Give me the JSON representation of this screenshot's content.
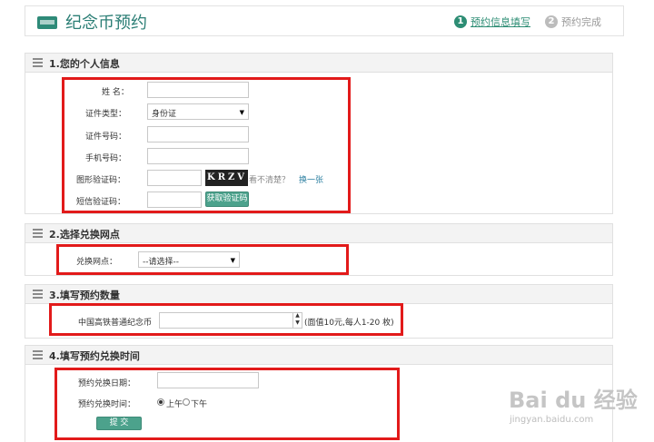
{
  "header": {
    "logo_text": "CRIT",
    "title": "纪念币预约",
    "steps": [
      {
        "num": "1",
        "label": "预约信息填写",
        "state": "active"
      },
      {
        "num": "2",
        "label": "预约完成",
        "state": "inactive"
      }
    ]
  },
  "section1": {
    "title": "1.您的个人信息",
    "name_label": "姓 名：",
    "name_value": "",
    "idtype_label": "证件类型：",
    "idtype_value": "身份证",
    "idnum_label": "证件号码：",
    "idnum_value": "",
    "phone_label": "手机号码：",
    "phone_value": "",
    "captcha_label": "图形验证码：",
    "captcha_value": "",
    "captcha_image_text": "KRZV",
    "captcha_hint": "看不清楚？",
    "captcha_refresh": "换一张",
    "sms_label": "短信验证码：",
    "sms_value": "",
    "sms_button": "获取验证码"
  },
  "section2": {
    "title": "2.选择兑换网点",
    "outlet_label": "兑换网点：",
    "outlet_value": "--请选择--"
  },
  "section3": {
    "title": "3.填写预约数量",
    "coin_label": "中国高铁普通纪念币",
    "coin_value": "",
    "coin_note": "(面值10元,每人1-20 枚)"
  },
  "section4": {
    "title": "4.填写预约兑换时间",
    "date_label": "预约兑换日期：",
    "date_value": "",
    "time_label": "预约兑换时间：",
    "time_options": [
      "上午",
      "下午"
    ],
    "time_selected": "上午",
    "submit_button": "提 交"
  },
  "watermark": {
    "brand": "Bai du 经验",
    "url": "jingyan.baidu.com"
  },
  "colors": {
    "brand_green": "#2b7e75",
    "button_green": "#4ca28c",
    "annotation_red": "#e21a1a"
  }
}
